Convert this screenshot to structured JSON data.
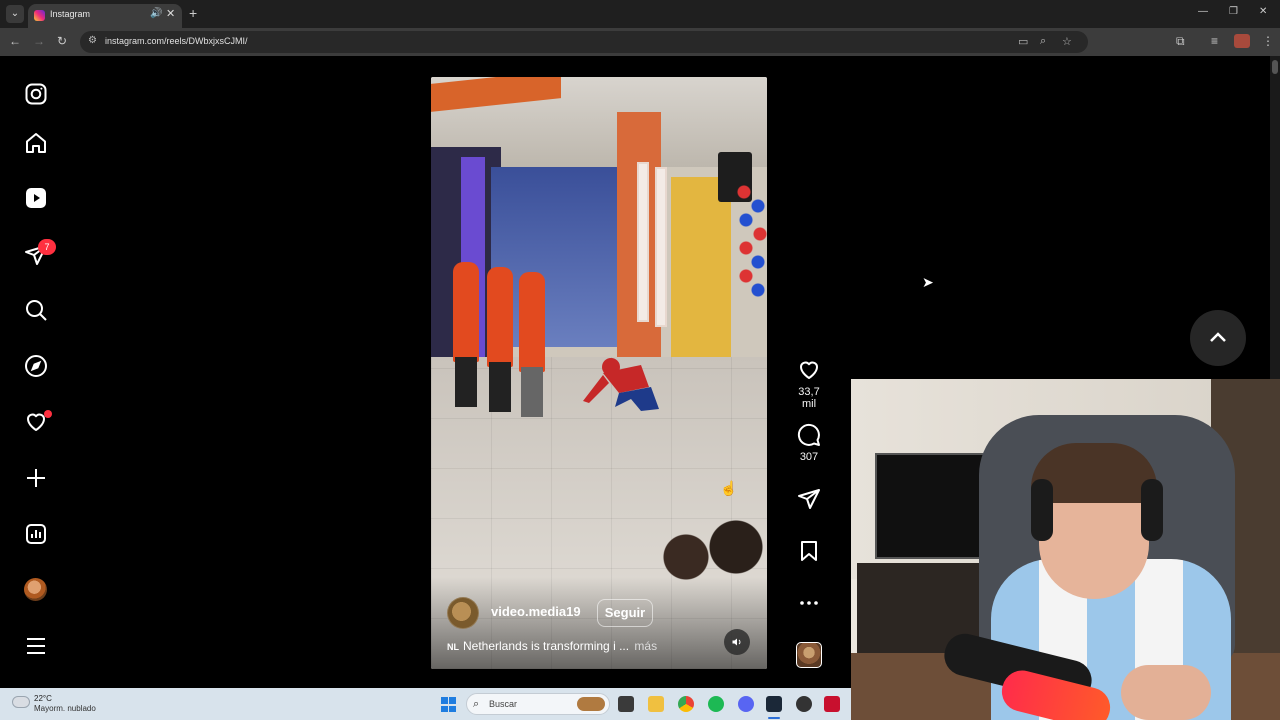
{
  "browser": {
    "tab_title": "Instagram",
    "url": "instagram.com/reels/DWbxjxsCJMI/"
  },
  "sidebar": {
    "notifications_badge": "7"
  },
  "reel": {
    "author": "video.media19",
    "follow_label": "Seguir",
    "caption_flag": "NL",
    "caption": "Netherlands is transforming i ...",
    "caption_more": "más",
    "likes": "33,7 mil",
    "comments": "307"
  },
  "taskbar": {
    "weather_temp": "22°C",
    "weather_desc": "Mayorm. nublado",
    "search_placeholder": "Buscar"
  },
  "colors": {
    "badge": "#ff3040",
    "page_bg": "#000000",
    "taskbar_bg": "#d8e3ec"
  }
}
